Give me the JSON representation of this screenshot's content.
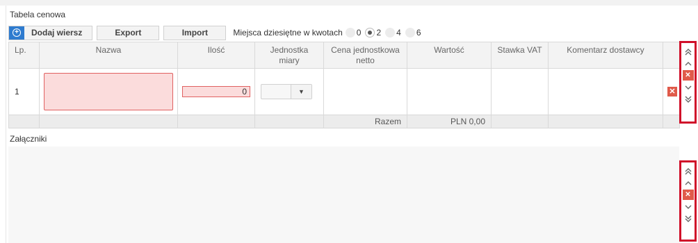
{
  "price_table": {
    "title": "Tabela cenowa",
    "toolbar": {
      "add_row_label": "Dodaj wiersz",
      "export_label": "Export",
      "import_label": "Import",
      "decimals_label": "Miejsca dziesiętne w kwotach",
      "decimal_options": [
        "0",
        "2",
        "4",
        "6"
      ],
      "decimal_selected": "2"
    },
    "columns": {
      "lp": "Lp.",
      "name": "Nazwa",
      "qty": "Ilość",
      "unit": "Jednostka miary",
      "unit_price": "Cena jednostkowa netto",
      "value": "Wartość",
      "vat": "Stawka VAT",
      "comment": "Komentarz dostawcy"
    },
    "rows": [
      {
        "lp": "1",
        "name": "",
        "qty": "0",
        "unit": "",
        "unit_price": "",
        "value": "",
        "vat": "",
        "comment": ""
      }
    ],
    "summary": {
      "label": "Razem",
      "total": "PLN 0,00"
    }
  },
  "attachments": {
    "title": "Załączniki"
  },
  "icons": {
    "add": "plus-circle-icon",
    "dropdown": "caret-down-icon",
    "delete": "delete-x-icon",
    "move_top": "double-chevron-up-icon",
    "move_up": "chevron-up-icon",
    "move_down": "chevron-down-icon",
    "move_bottom": "double-chevron-down-icon"
  },
  "colors": {
    "accent": "#2e7bcf",
    "error_fill": "#fbdcdc",
    "error_border": "#e06060",
    "delete": "#e05a4a",
    "highlight_frame": "#d0102a"
  }
}
